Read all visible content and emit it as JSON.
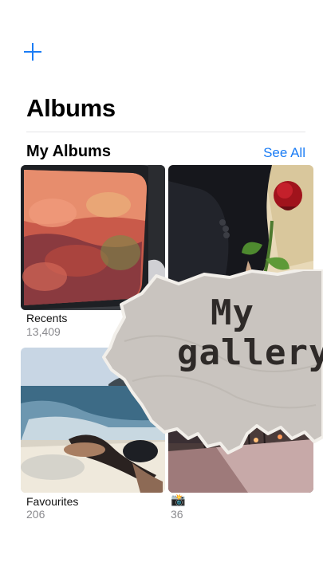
{
  "header": {
    "add_icon": "plus-icon",
    "title": "Albums"
  },
  "section": {
    "title": "My Albums",
    "see_all_label": "See All"
  },
  "albums": [
    {
      "name": "Recents",
      "count": "13,409"
    },
    {
      "name": "",
      "count": ""
    },
    {
      "name": "Favourites",
      "count": "206"
    },
    {
      "name": "📸",
      "count": "36"
    }
  ],
  "sticker": {
    "line1": "My",
    "line2": "gallery"
  },
  "colors": {
    "accent": "#1a7cf5",
    "secondary_text": "#8a8a8e",
    "paper": "#c9c4bf"
  }
}
